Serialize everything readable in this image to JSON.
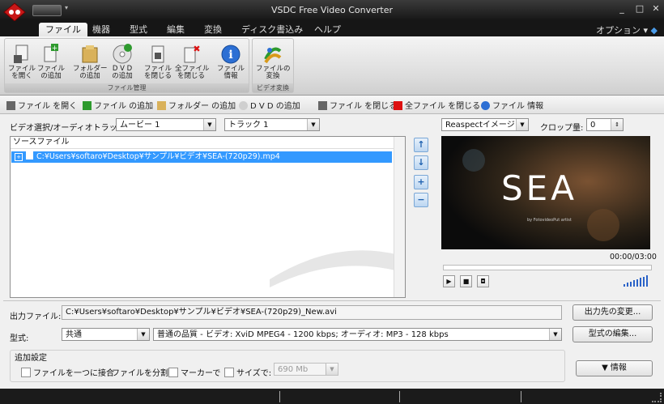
{
  "window": {
    "title": "VSDC Free Video Converter",
    "minimize": "_",
    "restore": "□",
    "close": "✕"
  },
  "menu": {
    "tabs": [
      {
        "label": "ファイル",
        "active": true
      },
      {
        "label": "機器"
      },
      {
        "label": "型式"
      },
      {
        "label": "編集"
      },
      {
        "label": "変換"
      },
      {
        "label": "ディスク書込み"
      },
      {
        "label": "ヘルプ"
      }
    ],
    "options_label": "オプション ▾"
  },
  "ribbon": {
    "groups": [
      {
        "label": "ファイル管理"
      },
      {
        "label": "ビデオ変換"
      }
    ],
    "buttons": [
      {
        "label": "ファイル\nを開く",
        "icon": "open-file-icon"
      },
      {
        "label": "ファイル\nの追加",
        "icon": "add-file-icon"
      },
      {
        "label": "フォルダー\nの追加",
        "icon": "folder-icon"
      },
      {
        "label": "D V D\nの追加",
        "icon": "dvd-icon"
      },
      {
        "label": "ファイル\nを閉じる",
        "icon": "close-file-icon"
      },
      {
        "label": "全ファイル\nを閉じる",
        "icon": "close-all-icon"
      },
      {
        "label": "ファイル\n情報",
        "icon": "info-icon"
      },
      {
        "label": "ファイルの\n変換",
        "icon": "convert-icon"
      }
    ]
  },
  "toolbar": {
    "items": [
      "ファイル を開く",
      "ファイル の追加",
      "フォルダー の追加",
      "D V D の追加",
      "ファイル を閉じる",
      "全ファイル を閉じる",
      "ファイル 情報"
    ]
  },
  "track": {
    "label": "ビデオ選択/オーディオトラック:",
    "video_value": "ムービー 1",
    "audio_value": "トラック 1"
  },
  "source": {
    "header": "ソースファイル",
    "files": [
      "C:¥Users¥softaro¥Desktop¥サンプル¥ビデオ¥SEA-(720p29).mp4"
    ]
  },
  "preview": {
    "aspect_value": "Reaspectイメージ",
    "crop_label": "クロップ量:",
    "crop_value": "0",
    "video_text": "SEA",
    "video_subtext": "by FotovideoPut artist",
    "time": "00:00/03:00"
  },
  "output": {
    "label": "出力ファイル:",
    "path": "C:¥Users¥softaro¥Desktop¥サンプル¥ビデオ¥SEA-(720p29)_New.avi",
    "change_button": "出力先の変更..."
  },
  "format": {
    "label": "型式:",
    "category": "共通",
    "preset": "普通の品質 - ビデオ: XviD MPEG4 - 1200 kbps; オーディオ: MP3 - 128 kbps",
    "edit_button": "型式の編集..."
  },
  "additional": {
    "title": "追加設定",
    "join_label": "ファイルを一つに接合",
    "split_label": "ファイルを分割:",
    "marker_label": "マーカーで",
    "size_label": "サイズで:",
    "size_value": "690 Mb",
    "info_button": "▼ 情報"
  }
}
